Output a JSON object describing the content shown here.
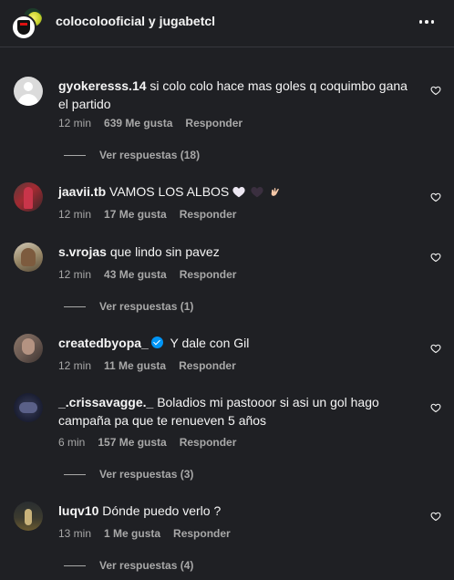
{
  "header": {
    "account_main": "colocolooficial",
    "joiner": "y",
    "account_collab": "jugabetcl",
    "more_icon": "more-horizontal-icon"
  },
  "comments": [
    {
      "username": "gyokeresss.14",
      "text": "si colo colo hace mas goles q coquimbo gana el partido",
      "time": "12 min",
      "likes": "639 Me gusta",
      "reply": "Responder",
      "replies": "Ver respuestas (18)",
      "avatar": "default-avatar"
    },
    {
      "username": "jaavii.tb",
      "text": "VAMOS LOS ALBOS",
      "emojis": [
        "white-heart-emoji",
        "black-heart-emoji",
        "call-me-hand-emoji"
      ],
      "time": "12 min",
      "likes": "17 Me gusta",
      "reply": "Responder"
    },
    {
      "username": "s.vrojas",
      "text": "que lindo sin pavez",
      "time": "12 min",
      "likes": "43 Me gusta",
      "reply": "Responder",
      "replies": "Ver respuestas (1)"
    },
    {
      "username": "createdbyopa_",
      "verified": true,
      "text": "Y dale con Gil",
      "time": "12 min",
      "likes": "11 Me gusta",
      "reply": "Responder"
    },
    {
      "username": "_.crissavagge._",
      "text": "Boladios mi pastooor si asi un gol hago campaña pa que te renueven 5 años",
      "time": "6 min",
      "likes": "157 Me gusta",
      "reply": "Responder",
      "replies": "Ver respuestas (3)"
    },
    {
      "username": "luqv10",
      "text": "Dónde puedo verlo ?",
      "time": "13 min",
      "likes": "1 Me gusta",
      "reply": "Responder",
      "replies": "Ver respuestas (4)"
    }
  ],
  "colors": {
    "background": "#1f2024",
    "primary_text": "#f5f5f5",
    "secondary_text": "#a8a8a8",
    "verified": "#0095f6"
  }
}
